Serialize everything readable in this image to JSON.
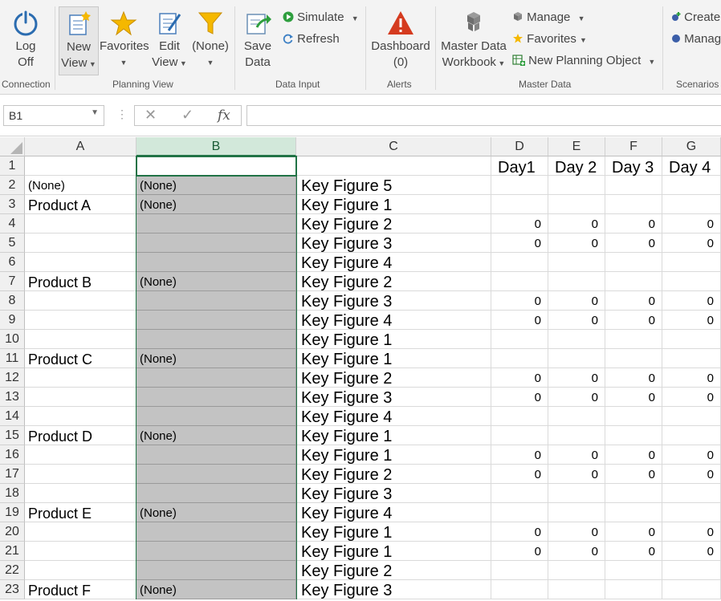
{
  "ribbon": {
    "log_off": {
      "line1": "Log",
      "line2": "Off"
    },
    "new_view": {
      "line1": "New",
      "line2": "View"
    },
    "favorites": {
      "line1": "Favorites"
    },
    "edit_view": {
      "line1": "Edit",
      "line2": "View"
    },
    "filter": {
      "line1": "(None)"
    },
    "save_data": {
      "line1": "Save",
      "line2": "Data"
    },
    "simulate": "Simulate",
    "refresh": "Refresh",
    "dashboard": {
      "line1": "Dashboard",
      "line2": "(0)"
    },
    "master_data_workbook": {
      "line1": "Master Data",
      "line2": "Workbook"
    },
    "manage": "Manage",
    "favorites_small": "Favorites",
    "new_planning_object": "New Planning Object",
    "create": "Create",
    "manage2": "Manag",
    "groups": {
      "connection": "Connection",
      "planning_view": "Planning View",
      "data_input": "Data Input",
      "alerts": "Alerts",
      "master_data": "Master Data",
      "scenarios": "Scenarios"
    }
  },
  "formula_bar": {
    "name_box": "B1",
    "fx": "fx",
    "formula": ""
  },
  "colors": {
    "accent": "#217346",
    "selected_col": "#d2e8da",
    "gray_cell": "#c3c3c3"
  },
  "columns": [
    "A",
    "B",
    "C",
    "D",
    "E",
    "F",
    "G"
  ],
  "rows": [
    {
      "n": "1",
      "a": "",
      "b": "",
      "c": "",
      "d": "Day1",
      "e": "Day 2",
      "f": "Day 3",
      "g": "Day 4"
    },
    {
      "n": "2",
      "a": "(None)",
      "b": "(None)",
      "c": "Key Figure 5",
      "d": "",
      "e": "",
      "f": "",
      "g": ""
    },
    {
      "n": "3",
      "a": "Product A",
      "b": "(None)",
      "c": "Key Figure 1",
      "d": "",
      "e": "",
      "f": "",
      "g": ""
    },
    {
      "n": "4",
      "a": "",
      "b": "",
      "c": "Key Figure 2",
      "d": "0",
      "e": "0",
      "f": "0",
      "g": "0"
    },
    {
      "n": "5",
      "a": "",
      "b": "",
      "c": "Key Figure 3",
      "d": "0",
      "e": "0",
      "f": "0",
      "g": "0"
    },
    {
      "n": "6",
      "a": "",
      "b": "",
      "c": "Key Figure 4",
      "d": "",
      "e": "",
      "f": "",
      "g": ""
    },
    {
      "n": "7",
      "a": "Product B",
      "b": "(None)",
      "c": "Key Figure 2",
      "d": "",
      "e": "",
      "f": "",
      "g": ""
    },
    {
      "n": "8",
      "a": "",
      "b": "",
      "c": "Key Figure 3",
      "d": "0",
      "e": "0",
      "f": "0",
      "g": "0"
    },
    {
      "n": "9",
      "a": "",
      "b": "",
      "c": "Key Figure 4",
      "d": "0",
      "e": "0",
      "f": "0",
      "g": "0"
    },
    {
      "n": "10",
      "a": "",
      "b": "",
      "c": "Key Figure 1",
      "d": "",
      "e": "",
      "f": "",
      "g": ""
    },
    {
      "n": "11",
      "a": "Product C",
      "b": "(None)",
      "c": "Key Figure 1",
      "d": "",
      "e": "",
      "f": "",
      "g": ""
    },
    {
      "n": "12",
      "a": "",
      "b": "",
      "c": "Key Figure 2",
      "d": "0",
      "e": "0",
      "f": "0",
      "g": "0"
    },
    {
      "n": "13",
      "a": "",
      "b": "",
      "c": "Key Figure 3",
      "d": "0",
      "e": "0",
      "f": "0",
      "g": "0"
    },
    {
      "n": "14",
      "a": "",
      "b": "",
      "c": "Key Figure 4",
      "d": "",
      "e": "",
      "f": "",
      "g": ""
    },
    {
      "n": "15",
      "a": "Product D",
      "b": "(None)",
      "c": "Key Figure 1",
      "d": "",
      "e": "",
      "f": "",
      "g": ""
    },
    {
      "n": "16",
      "a": "",
      "b": "",
      "c": "Key Figure 1",
      "d": "0",
      "e": "0",
      "f": "0",
      "g": "0"
    },
    {
      "n": "17",
      "a": "",
      "b": "",
      "c": "Key Figure 2",
      "d": "0",
      "e": "0",
      "f": "0",
      "g": "0"
    },
    {
      "n": "18",
      "a": "",
      "b": "",
      "c": "Key Figure 3",
      "d": "",
      "e": "",
      "f": "",
      "g": ""
    },
    {
      "n": "19",
      "a": "Product E",
      "b": "(None)",
      "c": "Key Figure 4",
      "d": "",
      "e": "",
      "f": "",
      "g": ""
    },
    {
      "n": "20",
      "a": "",
      "b": "",
      "c": "Key Figure 1",
      "d": "0",
      "e": "0",
      "f": "0",
      "g": "0"
    },
    {
      "n": "21",
      "a": "",
      "b": "",
      "c": "Key Figure 1",
      "d": "0",
      "e": "0",
      "f": "0",
      "g": "0"
    },
    {
      "n": "22",
      "a": "",
      "b": "",
      "c": "Key Figure 2",
      "d": "",
      "e": "",
      "f": "",
      "g": ""
    },
    {
      "n": "23",
      "a": "Product F",
      "b": "(None)",
      "c": "Key Figure 3",
      "d": "",
      "e": "",
      "f": "",
      "g": ""
    }
  ]
}
